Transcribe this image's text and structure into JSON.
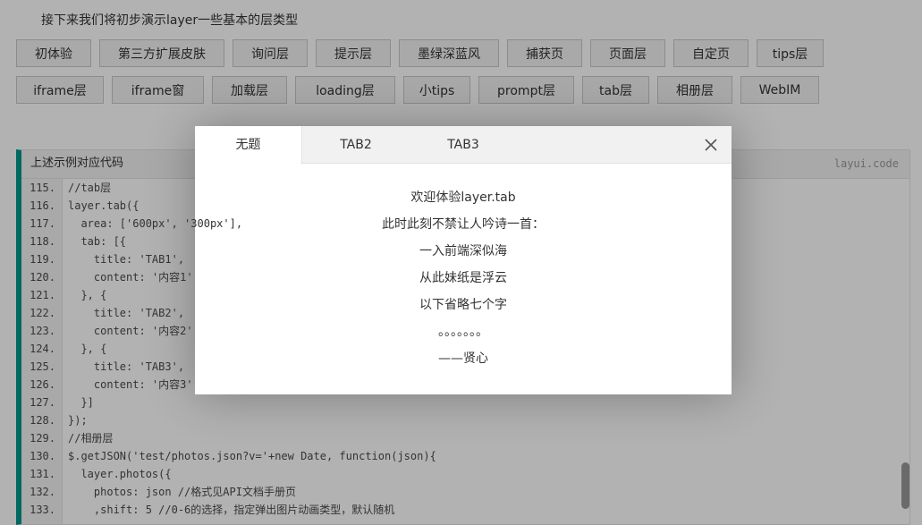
{
  "intro": "接下来我们将初步演示layer一些基本的层类型",
  "buttons_row1": [
    {
      "label": "初体验",
      "w": 84
    },
    {
      "label": "第三方扩展皮肤",
      "w": 140
    },
    {
      "label": "询问层",
      "w": 84
    },
    {
      "label": "提示层",
      "w": 84
    },
    {
      "label": "墨绿深蓝风",
      "w": 112
    },
    {
      "label": "捕获页",
      "w": 84
    },
    {
      "label": "页面层",
      "w": 84
    },
    {
      "label": "自定页",
      "w": 84
    },
    {
      "label": "tips层",
      "w": 75
    }
  ],
  "buttons_row2": [
    {
      "label": "iframe层",
      "w": 98
    },
    {
      "label": "iframe窗",
      "w": 103
    },
    {
      "label": "加载层",
      "w": 84
    },
    {
      "label": "loading层",
      "w": 112
    },
    {
      "label": "小tips",
      "w": 75
    },
    {
      "label": "prompt层",
      "w": 107
    },
    {
      "label": "tab层",
      "w": 75
    },
    {
      "label": "相册层",
      "w": 84
    },
    {
      "label": "WebIM",
      "w": 88
    }
  ],
  "code": {
    "header": "上述示例对应代码",
    "brand": "layui.code",
    "lines": [
      {
        "n": "115.",
        "t": "//tab层"
      },
      {
        "n": "116.",
        "t": "layer.tab({"
      },
      {
        "n": "117.",
        "t": "  area: ['600px', '300px'],"
      },
      {
        "n": "118.",
        "t": "  tab: [{"
      },
      {
        "n": "119.",
        "t": "    title: 'TAB1',"
      },
      {
        "n": "120.",
        "t": "    content: '内容1'"
      },
      {
        "n": "121.",
        "t": "  }, {"
      },
      {
        "n": "122.",
        "t": "    title: 'TAB2',"
      },
      {
        "n": "123.",
        "t": "    content: '内容2'"
      },
      {
        "n": "124.",
        "t": "  }, {"
      },
      {
        "n": "125.",
        "t": "    title: 'TAB3',"
      },
      {
        "n": "126.",
        "t": "    content: '内容3'"
      },
      {
        "n": "127.",
        "t": "  }]"
      },
      {
        "n": "128.",
        "t": "});"
      },
      {
        "n": "129.",
        "t": "//相册层"
      },
      {
        "n": "130.",
        "t": "$.getJSON('test/photos.json?v='+new Date, function(json){"
      },
      {
        "n": "131.",
        "t": "  layer.photos({"
      },
      {
        "n": "132.",
        "t": "    photos: json //格式见API文档手册页"
      },
      {
        "n": "133.",
        "t": "    ,shift: 5 //0-6的选择，指定弹出图片动画类型，默认随机"
      }
    ]
  },
  "dialog": {
    "tabs": [
      "无题",
      "TAB2",
      "TAB3"
    ],
    "close_icon": "close-icon",
    "content": [
      "欢迎体验layer.tab",
      "此时此刻不禁让人吟诗一首：",
      "一入前端深似海",
      "从此妹纸是浮云",
      "以下省略七个字",
      "。。。。。。。",
      "——贤心"
    ]
  }
}
